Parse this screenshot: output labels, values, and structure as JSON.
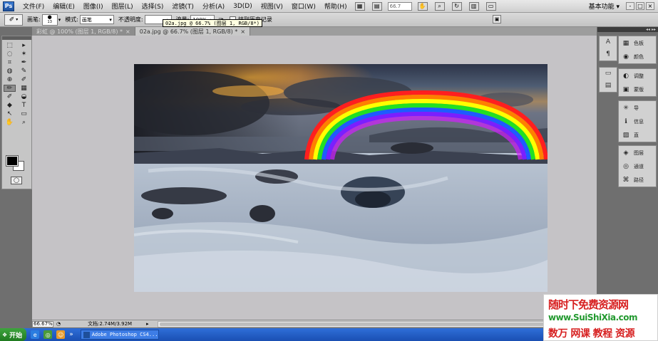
{
  "app": {
    "logo": "Ps"
  },
  "menubar": {
    "items": [
      "文件(F)",
      "编辑(E)",
      "图像(I)",
      "图层(L)",
      "选择(S)",
      "滤镜(T)",
      "分析(A)",
      "3D(D)",
      "视图(V)",
      "窗口(W)",
      "帮助(H)"
    ],
    "zoom": "66.7",
    "workspace": "基本功能 ▾",
    "window_buttons": [
      "-",
      "□",
      "×"
    ]
  },
  "options": {
    "brush_label": "画笔:",
    "brush_size": "13",
    "mode_label": "模式:",
    "mode_value": "画笔",
    "opacity_label": "不透明度:",
    "opacity_value": "",
    "flow_label": "流量:",
    "flow_value": "100%",
    "history_label": "抹到历史记录"
  },
  "tooltip": "02a.jpg @ 66.7% (图层 1, RGB/8*)",
  "tabs": [
    {
      "label": "彩虹 @ 100% (图层 1, RGB/8) *",
      "active": false
    },
    {
      "label": "02a.jpg @ 66.7% (图层 1, RGB/8) *",
      "active": true
    }
  ],
  "tools": [
    "⬚",
    "▸",
    "◌",
    "✶",
    "⌗",
    "✒",
    "◍",
    "✎",
    "⊕",
    "✐",
    "✏",
    "▦",
    "✐",
    "◒",
    "◆",
    "T",
    "↖",
    "▭",
    "✋",
    "⌕"
  ],
  "panels": {
    "dock_arrows": "◂◂ ▸▸",
    "mini": [
      "A",
      "¶",
      "▭",
      "▤"
    ],
    "groups": [
      [
        {
          "icon": "▦",
          "label": "色板"
        },
        {
          "icon": "◉",
          "label": "颜色"
        }
      ],
      [
        {
          "icon": "◐",
          "label": "调整"
        },
        {
          "icon": "▣",
          "label": "蒙版"
        }
      ],
      [
        {
          "icon": "✳",
          "label": "导"
        },
        {
          "icon": "ℹ",
          "label": "信息"
        },
        {
          "icon": "▨",
          "label": "直"
        }
      ],
      [
        {
          "icon": "◈",
          "label": "图层"
        },
        {
          "icon": "◎",
          "label": "通道"
        },
        {
          "icon": "⌘",
          "label": "路径"
        }
      ]
    ]
  },
  "status": {
    "zoom": "66.67%",
    "doc": "文档:2.74M/3.92M",
    "arrow": "▸"
  },
  "taskbar": {
    "start": "开始",
    "quick_launch": [
      "e",
      "◎",
      "☺"
    ],
    "expand": "»",
    "task": "Adobe Photoshop CS4..."
  },
  "watermark": {
    "line1": "随时下免费资源网",
    "line2": "www.SuiShiXia.com",
    "line3": "数万 网课 教程 资源"
  },
  "colors": {
    "rainbow": [
      "#ff1f1f",
      "#ff7f00",
      "#ffff00",
      "#22e022",
      "#1e5bff",
      "#7a1fff",
      "#d21fff"
    ]
  }
}
